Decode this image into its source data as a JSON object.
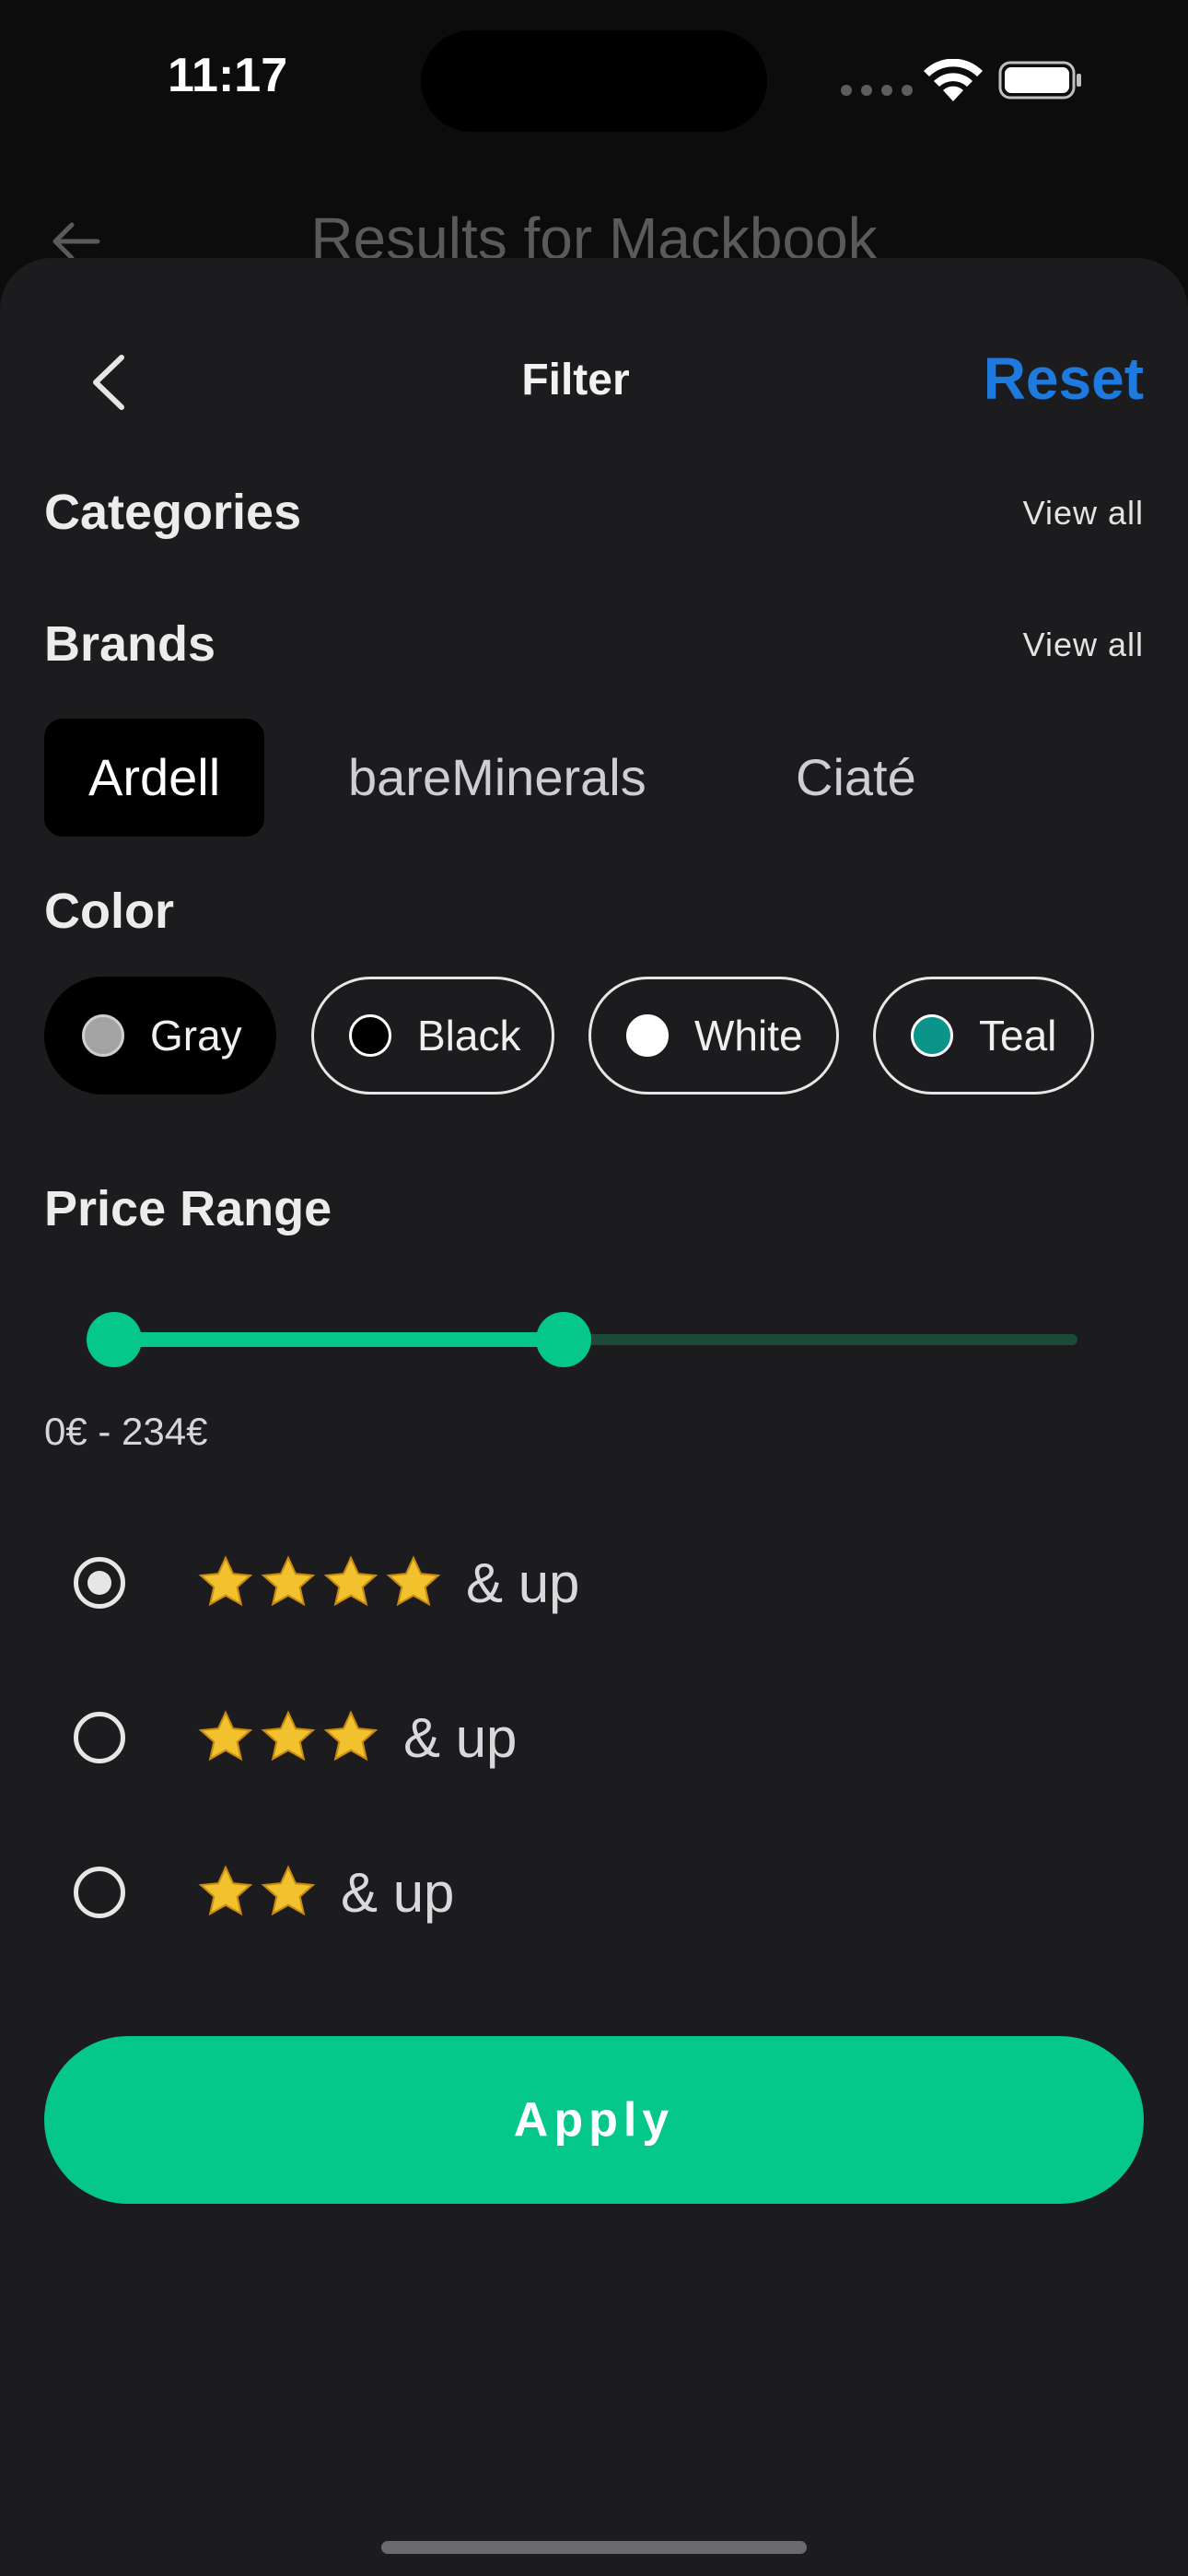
{
  "status_bar": {
    "time": "11:17"
  },
  "background_page": {
    "title": "Results for Mackbook"
  },
  "header": {
    "title": "Filter",
    "reset_label": "Reset"
  },
  "sections": {
    "categories": {
      "title": "Categories",
      "view_all": "View all"
    },
    "brands": {
      "title": "Brands",
      "view_all": "View all",
      "items": [
        {
          "label": "Ardell",
          "selected": true
        },
        {
          "label": "bareMinerals",
          "selected": false
        },
        {
          "label": "Ciaté",
          "selected": false
        }
      ]
    },
    "color": {
      "title": "Color",
      "items": [
        {
          "label": "Gray",
          "swatch": "#a3a3a3",
          "selected": true
        },
        {
          "label": "Black",
          "swatch": "#000000",
          "selected": false
        },
        {
          "label": "White",
          "swatch": "#ffffff",
          "selected": false
        },
        {
          "label": "Teal",
          "swatch": "#0a948a",
          "selected": false
        }
      ]
    },
    "price_range": {
      "title": "Price Range",
      "min": 0,
      "max": 234,
      "range_text": "0€ - 234€"
    },
    "ratings": [
      {
        "stars": 4,
        "label": "& up",
        "selected": true
      },
      {
        "stars": 3,
        "label": "& up",
        "selected": false
      },
      {
        "stars": 2,
        "label": "& up",
        "selected": false
      }
    ]
  },
  "apply_label": "Apply",
  "colors": {
    "accent": "#05c78a",
    "reset": "#1f7ae0",
    "sheet": "#1c1c1e"
  }
}
